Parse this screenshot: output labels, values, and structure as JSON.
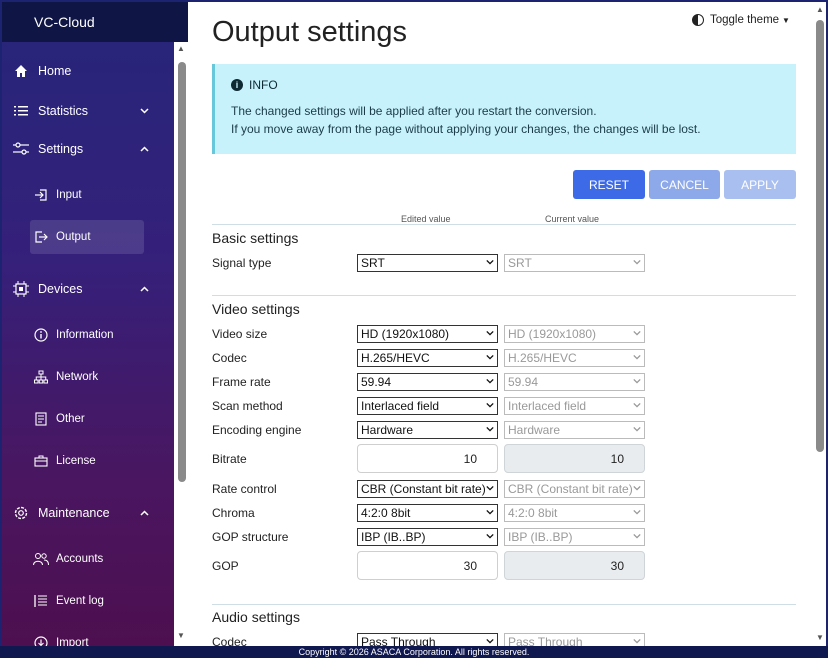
{
  "sidebar": {
    "brand": "VC-Cloud",
    "home": "Home",
    "statistics": "Statistics",
    "settings": "Settings",
    "settings_items": [
      "Input",
      "Output"
    ],
    "devices": "Devices",
    "devices_items": [
      "Information",
      "Network",
      "Other",
      "License"
    ],
    "maintenance": "Maintenance",
    "maintenance_items": [
      "Accounts",
      "Event log",
      "Import"
    ]
  },
  "header": {
    "title": "Output settings",
    "theme_toggle": "Toggle theme"
  },
  "info": {
    "heading": "INFO",
    "line1": "The changed settings will be applied after you restart the conversion.",
    "line2": "If you move away from the page without applying your changes, the changes will be lost."
  },
  "buttons": {
    "reset": "RESET",
    "cancel": "CANCEL",
    "apply": "APPLY"
  },
  "columns": {
    "edited": "Edited value",
    "current": "Current value"
  },
  "basic": {
    "title": "Basic settings",
    "signal_type": {
      "label": "Signal type",
      "edited": "SRT",
      "current": "SRT"
    }
  },
  "video": {
    "title": "Video settings",
    "video_size": {
      "label": "Video size",
      "edited": "HD (1920x1080)",
      "current": "HD (1920x1080)"
    },
    "codec": {
      "label": "Codec",
      "edited": "H.265/HEVC",
      "current": "H.265/HEVC"
    },
    "frame_rate": {
      "label": "Frame rate",
      "edited": "59.94",
      "current": "59.94"
    },
    "scan_method": {
      "label": "Scan method",
      "edited": "Interlaced field",
      "current": "Interlaced field"
    },
    "encoding_engine": {
      "label": "Encoding engine",
      "edited": "Hardware",
      "current": "Hardware"
    },
    "bitrate": {
      "label": "Bitrate",
      "edited": "10",
      "current": "10"
    },
    "rate_control": {
      "label": "Rate control",
      "edited": "CBR (Constant bit rate)",
      "current": "CBR (Constant bit rate)"
    },
    "chroma": {
      "label": "Chroma",
      "edited": "4:2:0 8bit",
      "current": "4:2:0 8bit"
    },
    "gop_structure": {
      "label": "GOP structure",
      "edited": "IBP (IB..BP)",
      "current": "IBP (IB..BP)"
    },
    "gop": {
      "label": "GOP",
      "edited": "30",
      "current": "30"
    }
  },
  "audio": {
    "title": "Audio settings",
    "codec": {
      "label": "Codec",
      "edited": "Pass Through",
      "current": "Pass Through"
    }
  },
  "footer": "Copyright © 2026 ASACA Corporation. All rights reserved.",
  "colors": {
    "primary": "#3d6ae6",
    "info_bg": "#c7f2fb",
    "sidebar_top": "#25267a",
    "sidebar_bottom": "#4d0f4f"
  }
}
